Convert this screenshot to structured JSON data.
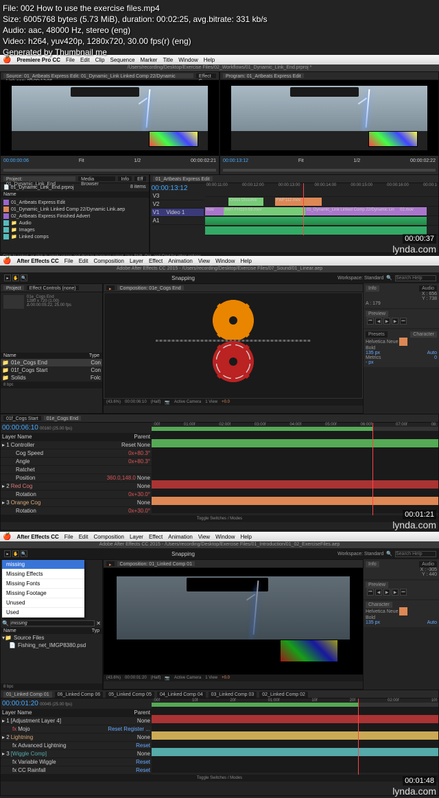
{
  "file_info": {
    "filename": "File: 002 How to use the exercise files.mp4",
    "size": "Size: 6005768 bytes (5.73 MiB), duration: 00:02:25, avg.bitrate: 331 kb/s",
    "audio": "Audio: aac, 48000 Hz, stereo (eng)",
    "video": "Video: h264, yuv420p, 1280x720, 30.00 fps(r) (eng)",
    "generator": "Generated by Thumbnail me"
  },
  "watermark": "lynda.com",
  "s1": {
    "ts": "00:00:37",
    "menu": {
      "app": "Premiere Pro CC",
      "items": [
        "File",
        "Edit",
        "Clip",
        "Sequence",
        "Marker",
        "Title",
        "Window",
        "Help"
      ]
    },
    "title": "/Users/recording/Desktop/Exercise Files/02_Workflows/01_Dynamic_Link_End.prproj *",
    "source_tab": "Source: 01_Artbeats Express Edit: 01_Dynamic_Link Linked Comp 22/Dynamic Link.aep: 00:00:13:06",
    "effect_tab": "Effect C",
    "program_tab": "Program: 01_Artbeats Express Edit",
    "src_tc1": "00:00:00:06",
    "src_fit": "Fit",
    "src_half": "1/2",
    "src_tc2": "00:00:02:21",
    "prg_tc1": "00:00:13:12",
    "prg_fit": "Fit",
    "prg_half": "1/2",
    "prg_tc2": "00:00:02:22",
    "proj_tab": "Project: 01_Dynamic_Link_End",
    "proj_tabs": [
      "Media Browser",
      "Info",
      "Eff",
      "M",
      "H"
    ],
    "proj_file": "01_Dynamic_Link_End.prproj",
    "proj_count": "8 items",
    "name_hdr": "Name",
    "items": [
      {
        "icon": "seq",
        "label": "01_Artbeats Express Edit"
      },
      {
        "icon": "ae",
        "label": "01_Dynamic_Link Linked Comp 22/Dynamic Link.aep"
      },
      {
        "icon": "seq",
        "label": "02_Artbeats Express Finished Advert"
      },
      {
        "icon": "folder",
        "label": "Audio"
      },
      {
        "icon": "folder",
        "label": "Images"
      },
      {
        "icon": "folder",
        "label": "Linked comps"
      }
    ],
    "seq_tab": "01_Artbeats Express Edit",
    "seq_tc": "00:00:13:12",
    "ruler": [
      "00:00:11:00",
      "00:00:12:00",
      "00:00:13:00",
      "00:00:14:00",
      "00:00:15:00",
      "00:00:16:00",
      "00:00:1"
    ],
    "tracks": {
      "v3": "V3",
      "v2": "V2",
      "v1": "V1",
      "video1": "Video 1",
      "a1": "A1"
    },
    "clips": {
      "cross": "Cross Dissolve",
      "fwf": "FWF112.mov",
      "bmt": "BMT-FH110-59.mov",
      "dl": "01_Dynamic_Link Linked Comp 22/Dynamic Lin",
      "m02": "02.mov",
      "mov": "mov"
    },
    "hint": "Click to select, or click in empty space and drag to marquee select. Use Shift, Opt, and Cmd for other options."
  },
  "s2": {
    "ts": "00:01:21",
    "menu": {
      "app": "After Effects CC",
      "items": [
        "File",
        "Edit",
        "Composition",
        "Layer",
        "Effect",
        "Animation",
        "View",
        "Window",
        "Help"
      ]
    },
    "title": "Adobe After Effects CC 2015 - /Users/recording/Desktop/Exercise Files/07_Sound/01_Linear.aep",
    "snapping": "Snapping",
    "workspace": "Workspace: Standard",
    "search": "Search Help",
    "proj_tab": "Project",
    "ec_tab": "Effect Controls (none)",
    "comp_info": {
      "name": "01e_Cogs End",
      "res": "1280 x 720 (1.00)",
      "dur": "Δ 00:00:05:22, 25.00 fps"
    },
    "comp_tab": "Composition: 01e_Cogs End",
    "name_hdr": "Name",
    "type_hdr": "Type",
    "items": [
      {
        "label": "01e_Cogs End",
        "type": "Con"
      },
      {
        "label": "01f_Cogs Start",
        "type": "Con"
      },
      {
        "label": "Solids",
        "type": "Folc"
      }
    ],
    "info": {
      "label": "Info",
      "audio": "Audio",
      "x": "X : 656",
      "y": "Y : 738",
      "r": "R :",
      "g": "G :",
      "b": "B :",
      "a": "A : 179"
    },
    "preview": "Preview",
    "presets": "Presets",
    "character": "Character",
    "font": "Helvetica Neue",
    "weight": "Bold",
    "fsize": "135 px",
    "auto": "Auto",
    "kern": "Metrics",
    "zero": "0",
    "px": "- px",
    "status": {
      "bpc": "8 bpc",
      "pct": "(43.6%)",
      "tc": "00:00:06:10",
      "res": "(Half)",
      "cam": "Active Camera",
      "view": "1 View",
      "exp": "+0.0"
    },
    "tl_tab1": "01f_Cogs Start",
    "tl_tab2": "01e_Cogs End",
    "tl_tc": "00:00:06:10",
    "tl_frames": "00160 (25.00 fps)",
    "ruler": [
      ":00f",
      "01:00f",
      "02:00f",
      "03:00f",
      "04:00f",
      "05:00f",
      "06:00f",
      "07:00f",
      "08:"
    ],
    "cols": [
      "Layer Name",
      "Parent"
    ],
    "layers": [
      {
        "n": "1",
        "name": "Controller",
        "val": "Reset",
        "parent": "None"
      },
      {
        "n": "",
        "name": "Cog Speed",
        "val": "0x+80.3°",
        "parent": ""
      },
      {
        "n": "",
        "name": "Angle",
        "val": "0x+80.3°",
        "parent": ""
      },
      {
        "n": "",
        "name": "Ratchet",
        "val": "",
        "parent": ""
      },
      {
        "n": "",
        "name": "Position",
        "val": "360.0,148.0",
        "parent": "None"
      },
      {
        "n": "2",
        "name": "Red Cog",
        "val": "",
        "parent": "None"
      },
      {
        "n": "",
        "name": "Rotation",
        "val": "0x+30.0°",
        "parent": ""
      },
      {
        "n": "3",
        "name": "Orange Cog",
        "val": "",
        "parent": "None"
      },
      {
        "n": "",
        "name": "Rotation",
        "val": "0x+30.0°",
        "parent": ""
      }
    ],
    "toggle": "Toggle Switches / Modes"
  },
  "s3": {
    "ts": "00:01:48",
    "menu": {
      "app": "After Effects CC",
      "items": [
        "File",
        "Edit",
        "Composition",
        "Layer",
        "Effect",
        "Animation",
        "View",
        "Window",
        "Help"
      ]
    },
    "title": "Adobe After Effects CC 2015 - /Users/recording/Desktop/Exercise Files/01_Introduction/01_02_ExerciseFiles.aep",
    "snapping": "Snapping",
    "workspace": "Workspace: Standard",
    "search": "Search Help",
    "popup": [
      "missing",
      "Missing Effects",
      "Missing Fonts",
      "Missing Footage",
      "Unused",
      "Used"
    ],
    "search_val": "missing",
    "name_hdr": "Name",
    "type_hdr": "Typ",
    "items": [
      {
        "label": "Source Files",
        "type": ""
      },
      {
        "label": "Fishing_net_IMGP8380.psd",
        "type": ""
      }
    ],
    "comp_tab": "Composition: 01_Linked Comp 01",
    "info": {
      "label": "Info",
      "audio": "Audio",
      "x": "X : -305",
      "y": "Y : 440",
      "rgba": "R :  G :  B :  A :"
    },
    "preview": "Preview",
    "character": "Character",
    "font": "Helvetica Neue",
    "weight": "Bold",
    "fsize": "135 px",
    "auto": "Auto",
    "status": {
      "bpc": "8 bpc",
      "pct": "(43.6%)",
      "tc": "00:00:01:20",
      "res": "(Half)",
      "cam": "Active Camera",
      "view": "1 View",
      "exp": "+0.0"
    },
    "tabs": [
      "01_Linked Comp 01",
      "06_Linked Comp 06",
      "05_Linked Comp 05",
      "04_Linked Comp 04",
      "03_Linked Comp 03",
      "02_Linked Comp 02"
    ],
    "tl_tc": "00:00:01:20",
    "tl_frames": "00045 (25.00 fps)",
    "ruler": [
      ":00f",
      "10f",
      "20f",
      "01:00f",
      "10f",
      "20f",
      "02:00f",
      "10f"
    ],
    "cols": [
      "Layer Name",
      "Parent"
    ],
    "layers": [
      {
        "n": "1",
        "name": "[Adjustment Layer 4]",
        "val": "",
        "parent": "None"
      },
      {
        "n": "",
        "name": "Mojo",
        "val": "Reset  Register  ...",
        "parent": ""
      },
      {
        "n": "2",
        "name": "Lightning",
        "val": "",
        "parent": "None"
      },
      {
        "n": "",
        "name": "Advanced Lightning",
        "val": "Reset",
        "parent": ""
      },
      {
        "n": "3",
        "name": "[Wiggle Comp]",
        "val": "",
        "parent": "None"
      },
      {
        "n": "",
        "name": "Variable Wiggle",
        "val": "Reset",
        "parent": ""
      },
      {
        "n": "",
        "name": "CC Rainfall",
        "val": "Reset",
        "parent": ""
      }
    ],
    "toggle": "Toggle Switches / Modes"
  }
}
